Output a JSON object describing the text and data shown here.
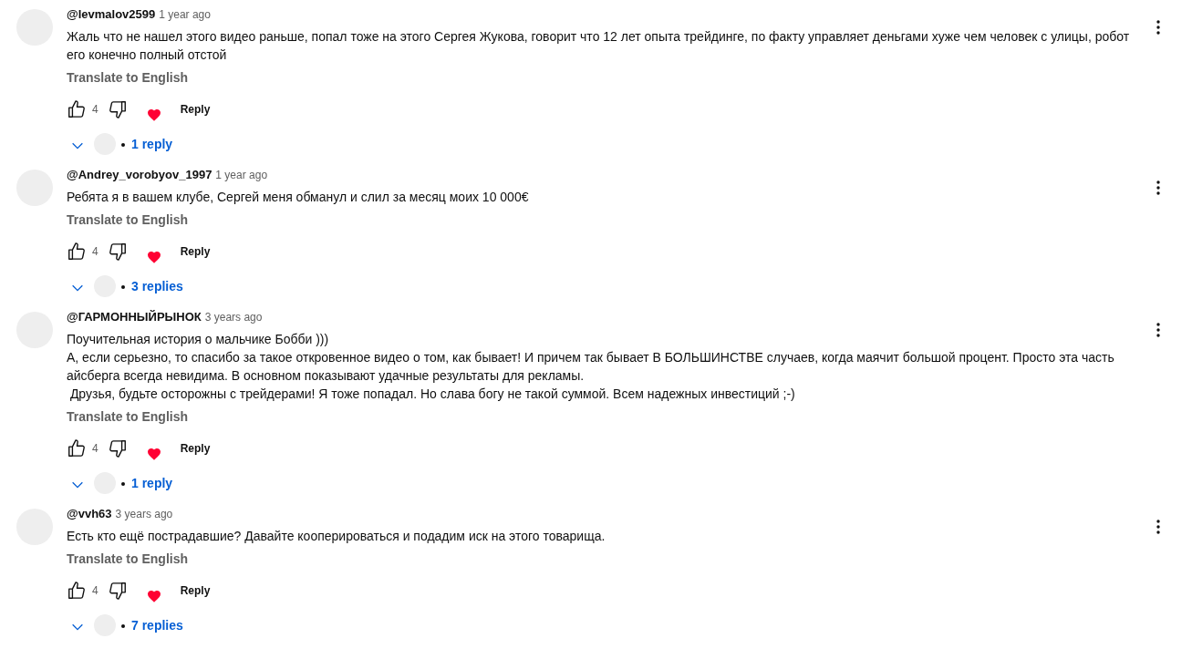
{
  "comments": [
    {
      "author": "@levmalov2599",
      "time": "1 year ago",
      "lines": [
        "Жаль что не нашел этого видео раньше, попал тоже на этого Сергея Жукова, говорит что 12 лет опыта трейдинге, по факту управляет деньгами хуже чем человек с улицы, робот его конечно полный отстой"
      ],
      "translate": "Translate to English",
      "likes": "4",
      "reply": "Reply",
      "replies": "1 reply"
    },
    {
      "author": "@Andrey_vorobyov_1997",
      "time": "1 year ago",
      "lines": [
        "Ребята я в вашем клубе, Сергей меня обманул и слил за месяц моих 10 000€"
      ],
      "translate": "Translate to English",
      "likes": "4",
      "reply": "Reply",
      "replies": "3 replies"
    },
    {
      "author": "@ГАРМОННЫЙРЫНОК",
      "time": "3 years ago",
      "lines": [
        "Поучительная история о мальчике Бобби )))",
        "А, если серьезно, то спасибо за такое откровенное видео о том, как бывает! И причем так бывает В БОЛЬШИНСТВЕ случаев, когда маячит большой процент. Просто эта часть айсберга всегда невидима. В основном показывают удачные результаты для рекламы.",
        " Друзья, будьте осторожны с трейдерами! Я тоже попадал. Но слава богу не такой суммой. Всем надежных инвестиций ;-)"
      ],
      "translate": "Translate to English",
      "likes": "4",
      "reply": "Reply",
      "replies": "1 reply"
    },
    {
      "author": "@vvh63",
      "time": "3 years ago",
      "lines": [
        "Есть кто ещё пострадавшие? Давайте кооперироваться и подадим иск на этого товарища."
      ],
      "translate": "Translate to English",
      "likes": "4",
      "reply": "Reply",
      "replies": "7 replies"
    }
  ]
}
